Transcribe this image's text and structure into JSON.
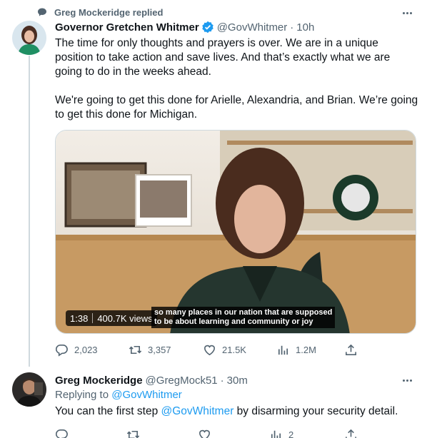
{
  "social_context": {
    "text": "Greg Mockeridge replied"
  },
  "main_tweet": {
    "author_name": "Governor Gretchen Whitmer",
    "handle": "@GovWhitmer",
    "separator": "·",
    "time": "10h",
    "text_p1": "The time for only thoughts and prayers is over. We are in a unique position to take action and save lives. And that’s exactly what we are going to do in the weeks ahead.",
    "text_p2": "We're going to get this done for Arielle, Alexandria, and Brian. We’re going to get this done for Michigan.",
    "video": {
      "duration": "1:38",
      "views": "400.7K views",
      "caption_line1": "so many places in our nation that are supposed",
      "caption_line2": "to be about learning and community or joy"
    },
    "stats": {
      "replies": "2,023",
      "retweets": "3,357",
      "likes": "21.5K",
      "views": "1.2M"
    }
  },
  "reply_tweet": {
    "author_name": "Greg Mockeridge",
    "handle": "@GregMock51",
    "separator": "·",
    "time": "30m",
    "replying_to_label": "Replying to",
    "replying_to_handle": "@GovWhitmer",
    "text_before": "You can the first step",
    "text_mention": "@GovWhitmer",
    "text_after": "by disarming your security detail.",
    "stats": {
      "replies": "",
      "retweets": "",
      "likes": "",
      "views": "2"
    }
  },
  "colors": {
    "accent": "#1d9bf0",
    "muted": "#536471",
    "text": "#0f1419",
    "thread_line": "#cfd9de"
  }
}
